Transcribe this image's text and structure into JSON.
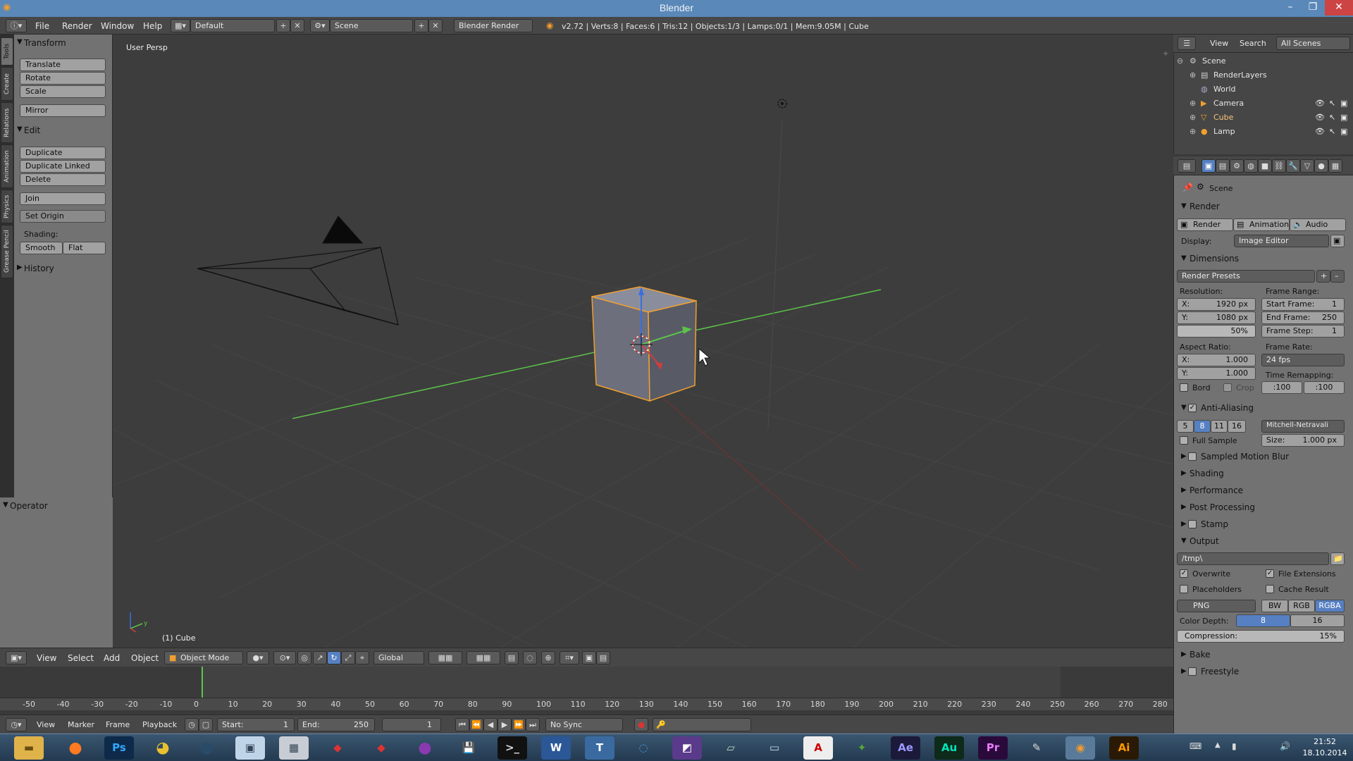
{
  "window": {
    "title": "Blender"
  },
  "info": {
    "menus": [
      "File",
      "Render",
      "Window",
      "Help"
    ],
    "screen_layout": "Default",
    "scene": "Scene",
    "engine": "Blender Render",
    "stats": "v2.72 | Verts:8 | Faces:6 | Tris:12 | Objects:1/3 | Lamps:0/1 | Mem:9.05M | Cube"
  },
  "left_tabs": [
    "Tools",
    "Create",
    "Relations",
    "Animation",
    "Physics",
    "Grease Pencil"
  ],
  "toolshelf": {
    "transform_title": "Transform",
    "translate": "Translate",
    "rotate": "Rotate",
    "scale": "Scale",
    "mirror": "Mirror",
    "edit_title": "Edit",
    "duplicate": "Duplicate",
    "duplicate_linked": "Duplicate Linked",
    "delete": "Delete",
    "join": "Join",
    "set_origin": "Set Origin",
    "shading_label": "Shading:",
    "smooth": "Smooth",
    "flat": "Flat",
    "history_title": "History",
    "operator_title": "Operator"
  },
  "viewport": {
    "view_label": "User Persp",
    "object_label": "(1) Cube"
  },
  "v3d_header": {
    "view": "View",
    "select": "Select",
    "add": "Add",
    "object": "Object",
    "mode": "Object Mode",
    "orientation": "Global"
  },
  "timeline": {
    "ruler_ticks": [
      "-50",
      "-40",
      "-30",
      "-20",
      "-10",
      "0",
      "10",
      "20",
      "30",
      "40",
      "50",
      "60",
      "70",
      "80",
      "90",
      "100",
      "110",
      "120",
      "130",
      "140",
      "150",
      "160",
      "170",
      "180",
      "190",
      "200",
      "210",
      "220",
      "230",
      "240",
      "250",
      "260",
      "270",
      "280"
    ],
    "current_frame": 1,
    "menus": [
      "View",
      "Marker",
      "Frame",
      "Playback"
    ],
    "start": "Start:",
    "start_val": "1",
    "end": "End:",
    "end_val": "250",
    "frame_val": "1",
    "sync": "No Sync"
  },
  "outliner": {
    "view": "View",
    "search": "Search",
    "filter": "All Scenes",
    "items": [
      "Scene",
      "RenderLayers",
      "World",
      "Camera",
      "Cube",
      "Lamp"
    ]
  },
  "properties": {
    "context": "Scene",
    "render_title": "Render",
    "render_btn": "Render",
    "animation_btn": "Animation",
    "audio_btn": "Audio",
    "display_label": "Display:",
    "display_value": "Image Editor",
    "dimensions_title": "Dimensions",
    "render_presets": "Render Presets",
    "resolution_label": "Resolution:",
    "res_x": "X:",
    "res_x_val": "1920 px",
    "res_y": "Y:",
    "res_y_val": "1080 px",
    "res_pct": "50%",
    "frame_range_label": "Frame Range:",
    "start_frame": "Start Frame:",
    "start_frame_val": "1",
    "end_frame": "End Frame:",
    "end_frame_val": "250",
    "frame_step": "Frame Step:",
    "frame_step_val": "1",
    "aspect_label": "Aspect Ratio:",
    "asp_x": "X:",
    "asp_x_val": "1.000",
    "asp_y": "Y:",
    "asp_y_val": "1.000",
    "frame_rate_label": "Frame Rate:",
    "frame_rate": "24 fps",
    "time_remap_label": "Time Remapping:",
    "remap_old": ":100",
    "remap_new": ":100",
    "bord": "Bord",
    "crop": "Crop",
    "aa_title": "Anti-Aliasing",
    "aa_samples": [
      "5",
      "8",
      "11",
      "16"
    ],
    "aa_selected": "8",
    "aa_filter": "Mitchell-Netravali",
    "full_sample": "Full Sample",
    "size_label": "Size:",
    "size_val": "1.000 px",
    "sampled_motion_blur": "Sampled Motion Blur",
    "shading": "Shading",
    "performance": "Performance",
    "post_processing": "Post Processing",
    "stamp": "Stamp",
    "output_title": "Output",
    "output_path": "/tmp\\",
    "overwrite": "Overwrite",
    "file_extensions": "File Extensions",
    "placeholders": "Placeholders",
    "cache_result": "Cache Result",
    "format": "PNG",
    "bw": "BW",
    "rgb": "RGB",
    "rgba": "RGBA",
    "color_depth_label": "Color Depth:",
    "depth_8": "8",
    "depth_16": "16",
    "compression_label": "Compression:",
    "compression_val": "15%",
    "bake": "Bake",
    "freestyle": "Freestyle"
  },
  "taskbar": {
    "apps": [
      "Ps",
      "Ae",
      "Au",
      "Pr",
      "Ai"
    ],
    "time": "21:52",
    "date": "18.10.2014"
  },
  "colors": {
    "selected": "#5680c2",
    "object_outline": "#f0a030",
    "x_axis": "#d23c3c",
    "y_axis": "#5cc24a",
    "z_axis": "#3a6ee0"
  }
}
